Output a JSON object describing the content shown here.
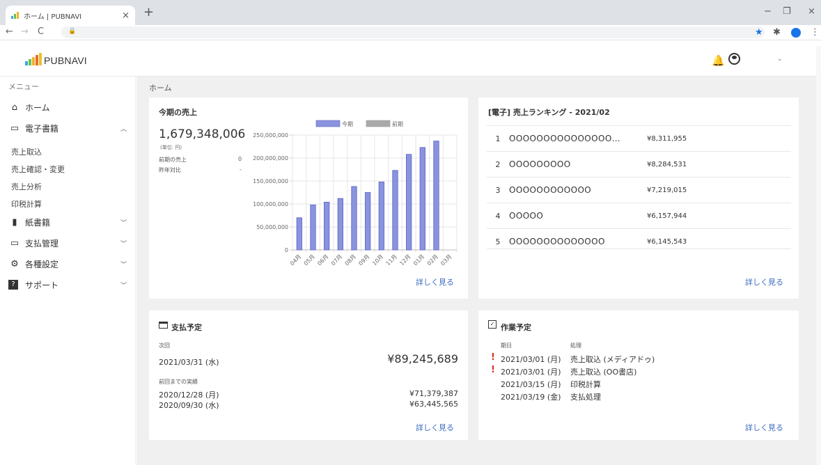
{
  "browser": {
    "tab_title": "ホーム | PUBNAVI",
    "tab_close": "×",
    "new_tab": "+",
    "back": "←",
    "forward": "→",
    "reload": "C",
    "minimize": "−",
    "restore": "❐",
    "close": "×"
  },
  "header": {
    "logo_text": "PUBNAVI"
  },
  "sidebar": {
    "menu_label": "メニュー",
    "home": "ホーム",
    "ebook": "電子書籍",
    "ebook_sub": [
      "売上取込",
      "売上確認・変更",
      "売上分析",
      "印税計算"
    ],
    "paper": "紙書籍",
    "payment": "支払管理",
    "settings": "各種設定",
    "support": "サポート"
  },
  "main": {
    "breadcrumb": "ホーム",
    "more_link": "詳しく見る"
  },
  "sales": {
    "title": "今期の売上",
    "total": "1,679,348,006",
    "unit": "(単位: 円)",
    "prev_label": "前期の売上",
    "prev_value": "0",
    "yoy_label": "昨年対比",
    "yoy_value": "-"
  },
  "ranking": {
    "title": "[電子] 売上ランキング - 2021/02",
    "items": [
      {
        "rank": "1",
        "name": "OOOOOOOOOOOOOOO…",
        "amount": "¥8,311,955"
      },
      {
        "rank": "2",
        "name": "OOOOOOOOO",
        "amount": "¥8,284,531"
      },
      {
        "rank": "3",
        "name": "OOOOOOOOOOOO",
        "amount": "¥7,219,015"
      },
      {
        "rank": "4",
        "name": "OOOOO",
        "amount": "¥6,157,944"
      },
      {
        "rank": "5",
        "name": "OOOOOOOOOOOOOO",
        "amount": "¥6,145,543"
      }
    ]
  },
  "payment": {
    "title": "支払予定",
    "next_label": "次回",
    "next_date": "2021/03/31 (水)",
    "next_amount": "¥89,245,689",
    "history_label": "前回までの実績",
    "history": [
      {
        "date": "2020/12/28 (月)",
        "amount": "¥71,379,387"
      },
      {
        "date": "2020/09/30 (水)",
        "amount": "¥63,445,565"
      }
    ]
  },
  "tasks": {
    "title": "作業予定",
    "col_date": "期日",
    "col_task": "処理",
    "items": [
      {
        "date": "2021/03/01 (月)",
        "task": "売上取込 (メディアドゥ)",
        "alert": true
      },
      {
        "date": "2021/03/01 (月)",
        "task": "売上取込 (OO書店)",
        "alert": true
      },
      {
        "date": "2021/03/15 (月)",
        "task": "印税計算",
        "alert": false
      },
      {
        "date": "2021/03/19 (金)",
        "task": "支払処理",
        "alert": false
      }
    ]
  },
  "colors": {
    "bar_current": "#8a93dd",
    "bar_current_border": "#5a64c8",
    "bar_previous": "#aaaaaa",
    "link": "#3d6cc0",
    "alert": "#d93025"
  },
  "chart_data": {
    "type": "bar",
    "categories": [
      "04月",
      "05月",
      "06月",
      "07月",
      "08月",
      "09月",
      "10月",
      "11月",
      "12月",
      "01月",
      "02月",
      "03月"
    ],
    "series": [
      {
        "name": "今期",
        "values": [
          70000000,
          98000000,
          104000000,
          112000000,
          138000000,
          125000000,
          148000000,
          173000000,
          208000000,
          223000000,
          237000000,
          0
        ]
      },
      {
        "name": "前期",
        "values": [
          0,
          0,
          0,
          0,
          0,
          0,
          0,
          0,
          0,
          0,
          0,
          0
        ]
      }
    ],
    "ylim": [
      0,
      250000000
    ],
    "yticks": [
      "0",
      "50,000,000",
      "100,000,000",
      "150,000,000",
      "200,000,000",
      "250,000,000"
    ],
    "legend": "top",
    "grid": true
  }
}
